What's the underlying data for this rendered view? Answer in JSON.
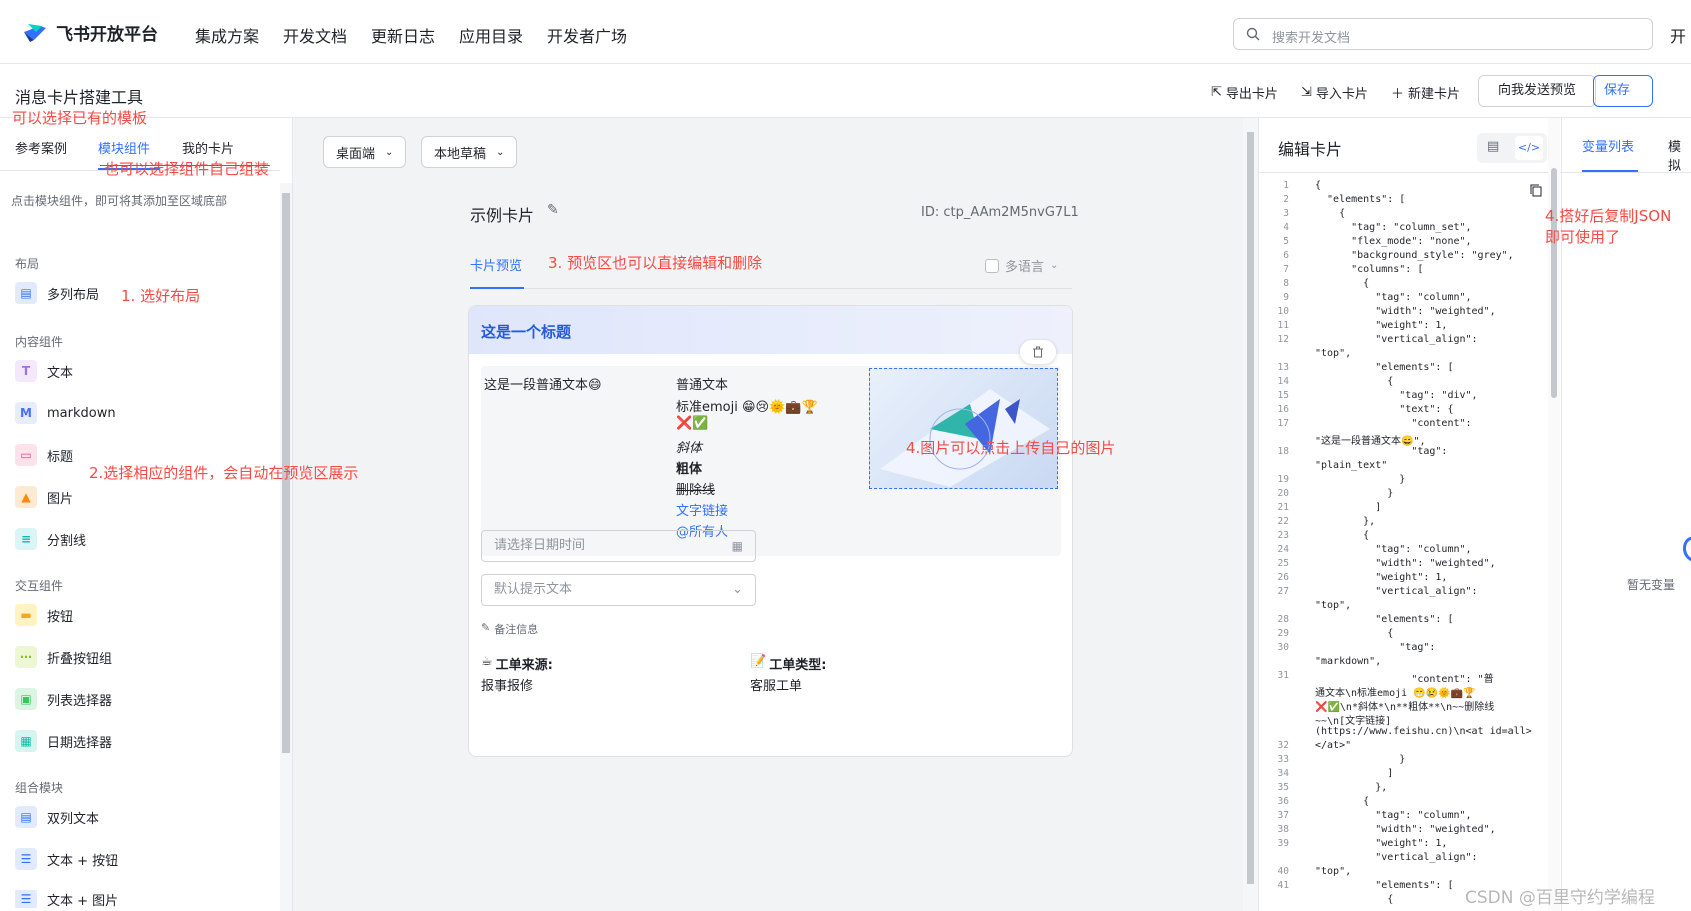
{
  "nav": {
    "brand": "飞书开放平台",
    "items": [
      "集成方案",
      "开发文档",
      "更新日志",
      "应用目录",
      "开发者广场"
    ],
    "search_placeholder": "搜索开发文档",
    "cut_item": "开"
  },
  "toolbar": {
    "title": "消息卡片搭建工具",
    "export": "导出卡片",
    "import": "导入卡片",
    "new": "新建卡片",
    "send_preview": "向我发送预览",
    "save": "保存"
  },
  "left": {
    "tabs": [
      "参考案例",
      "模块组件",
      "我的卡片"
    ],
    "hint": "点击模块组件，即可将其添加至区域底部",
    "sections": {
      "layout": "布局",
      "content": "内容组件",
      "interactive": "交互组件",
      "combo": "组合模块"
    },
    "layout_items": [
      "多列布局"
    ],
    "content_items": [
      "文本",
      "markdown",
      "标题",
      "图片",
      "分割线"
    ],
    "interactive_items": [
      "按钮",
      "折叠按钮组",
      "列表选择器",
      "日期选择器"
    ],
    "combo_items": [
      "双列文本",
      "文本 + 按钮",
      "文本 + 图片"
    ]
  },
  "canvas": {
    "device": "桌面端",
    "draft": "本地草稿",
    "card_title": "示例卡片",
    "card_id": "ID: ctp_AAm2M5nvG7L1",
    "preview_tab": "卡片预览",
    "multilang": "多语言"
  },
  "card": {
    "header": "这是一个标题",
    "plain_text": "这是一段普通文本😄",
    "md_plain": "普通文本",
    "md_emoji": "标准emoji 😁😢🌞💼🏆",
    "md_marks": "❌✅",
    "md_italic": "斜体",
    "md_bold": "粗体",
    "md_strike": "删除线",
    "md_link": "文字链接",
    "md_at": "@所有人",
    "date_placeholder": "请选择日期时间",
    "select_placeholder": "默认提示文本",
    "note": "备注信息",
    "source_label": "工单来源:",
    "source_value": "报事报修",
    "type_label": "工单类型:",
    "type_value": "客服工单"
  },
  "editor": {
    "title": "编辑卡片",
    "line_numbers": [
      "1",
      "2",
      "3",
      "4",
      "5",
      "6",
      "7",
      "8",
      "9",
      "10",
      "11",
      "12",
      "",
      "13",
      "14",
      "15",
      "16",
      "17",
      "",
      "18",
      "",
      "19",
      "20",
      "21",
      "22",
      "23",
      "24",
      "25",
      "26",
      "27",
      "",
      "28",
      "29",
      "30",
      "",
      "31",
      "",
      "",
      "",
      "",
      "32",
      "33",
      "34",
      "35",
      "36",
      "37",
      "38",
      "39",
      "",
      "40",
      "41"
    ],
    "lines": [
      "{",
      "  \"elements\": [",
      "    {",
      "      \"tag\": \"column_set\",",
      "      \"flex_mode\": \"none\",",
      "      \"background_style\": \"grey\",",
      "      \"columns\": [",
      "        {",
      "          \"tag\": \"column\",",
      "          \"width\": \"weighted\",",
      "          \"weight\": 1,",
      "          \"vertical_align\":",
      "\"top\",",
      "          \"elements\": [",
      "            {",
      "              \"tag\": \"div\",",
      "              \"text\": {",
      "                \"content\":",
      "\"这是一段普通文本😄\",",
      "                \"tag\":",
      "\"plain_text\"",
      "              }",
      "            }",
      "          ]",
      "        },",
      "        {",
      "          \"tag\": \"column\",",
      "          \"width\": \"weighted\",",
      "          \"weight\": 1,",
      "          \"vertical_align\":",
      "\"top\",",
      "          \"elements\": [",
      "            {",
      "              \"tag\":",
      "\"markdown\",",
      "                \"content\": \"普",
      "通文本\\n标准emoji 😁😢🌞💼🏆",
      "❌✅\\n*斜体*\\n**粗体**\\n~~删除线",
      "~~\\n[文字链接]",
      "(https://www.feishu.cn)\\n<at id=all>",
      "</at>\"",
      "              }",
      "            ]",
      "          },",
      "        {",
      "          \"tag\": \"column\",",
      "          \"width\": \"weighted\",",
      "          \"weight\": 1,",
      "          \"vertical_align\":",
      "\"top\",",
      "          \"elements\": [",
      "            {"
    ]
  },
  "varpanel": {
    "tab": "变量列表",
    "tab2": "模拟",
    "empty": "暂无变量"
  },
  "annotations": {
    "a0": "可以选择已有的模板",
    "a0b": "也可以选择组件自己组装",
    "a1": "1. 选好布局",
    "a2": "2.选择相应的组件，会自动在预览区展示",
    "a3": "3. 预览区也可以直接编辑和删除",
    "a4": "4.图片可以点击上传自己的图片",
    "a5": "4.搭好后复制JSON",
    "a5b": "即可使用了"
  },
  "watermark": "CSDN @百里守约学编程"
}
